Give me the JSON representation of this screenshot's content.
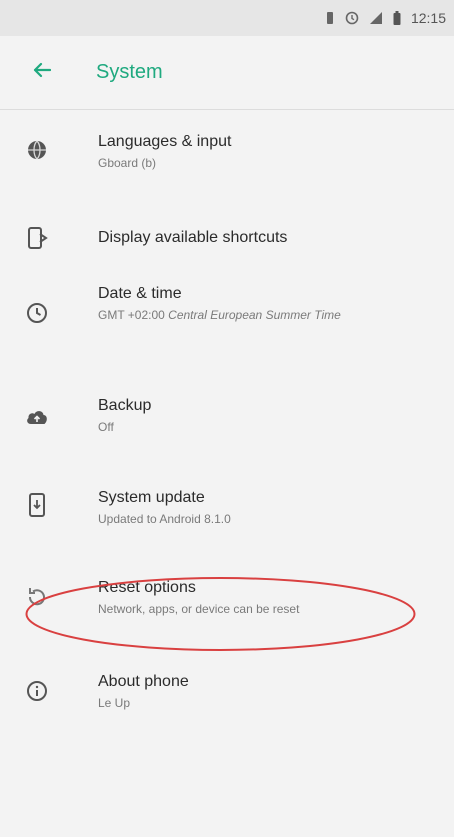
{
  "status_bar": {
    "time": "12:15",
    "icons": [
      "vibrate-icon",
      "alarm-icon",
      "signal-icon",
      "battery-icon"
    ]
  },
  "app_bar": {
    "title": "System",
    "back_icon": "arrow-back-icon",
    "accent_color": "#1fa97f"
  },
  "settings": [
    {
      "icon": "globe-icon",
      "title": "Languages & input",
      "subtitle": "Gboard (b)"
    },
    {
      "icon": "shortcut-icon",
      "title": "Display available shortcuts",
      "subtitle": ""
    },
    {
      "icon": "clock-icon",
      "title": "Date & time",
      "subtitle_prefix": "GMT +02:00",
      "subtitle": "Central European Summer Time"
    },
    {
      "icon": "cloud-upload-icon",
      "title": "Backup",
      "subtitle": "Off"
    },
    {
      "icon": "system-update-icon",
      "title": "System update",
      "subtitle": "Updated to Android 8.1.0"
    },
    {
      "icon": "reset-icon",
      "title": "Reset options",
      "subtitle": "Network, apps, or device can be reset"
    },
    {
      "icon": "info-icon",
      "title": "About phone",
      "subtitle": "Le Up"
    }
  ],
  "annotation": {
    "ellipse_color": "#d94040"
  }
}
